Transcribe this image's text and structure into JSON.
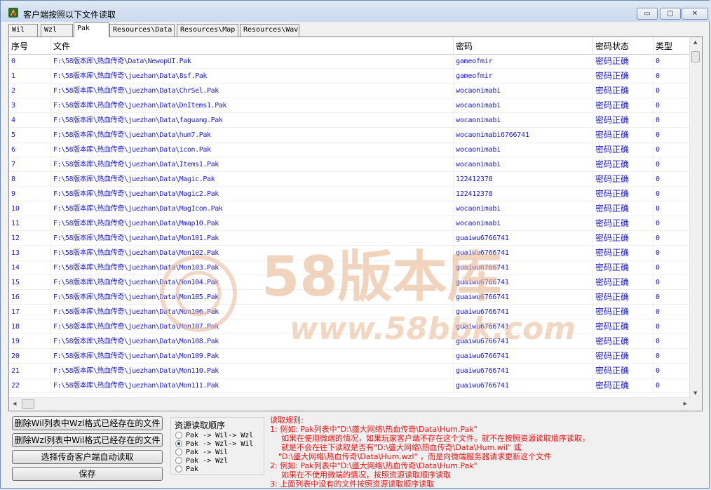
{
  "window": {
    "title": "客户端按照以下文件读取",
    "minimize": "▭",
    "maximize": "▢",
    "close": "✕"
  },
  "tabs": [
    "Wil",
    "Wzl",
    "Pak",
    "Resources\\Data",
    "Resources\\Map",
    "Resources\\Wav"
  ],
  "active_tab": "Pak",
  "table": {
    "headers": [
      "序号",
      "文件",
      "密码",
      "密码状态",
      "类型"
    ],
    "rows": [
      [
        "0",
        "F:\\58版本库\\热血传奇\\Data\\NewopUI.Pak",
        "gameofmir",
        "密码正确",
        "0"
      ],
      [
        "1",
        "F:\\58版本库\\热血传奇\\juezhan\\Data\\8sf.Pak",
        "gameofmir",
        "密码正确",
        "0"
      ],
      [
        "2",
        "F:\\58版本库\\热血传奇\\juezhan\\Data\\ChrSel.Pak",
        "wocaonimabi",
        "密码正确",
        "0"
      ],
      [
        "3",
        "F:\\58版本库\\热血传奇\\juezhan\\Data\\DnItems1.Pak",
        "wocaonimabi",
        "密码正确",
        "0"
      ],
      [
        "4",
        "F:\\58版本库\\热血传奇\\juezhan\\Data\\faguang.Pak",
        "wocaonimabi",
        "密码正确",
        "0"
      ],
      [
        "5",
        "F:\\58版本库\\热血传奇\\juezhan\\Data\\hum7.Pak",
        "wocaonimabi6766741",
        "密码正确",
        "0"
      ],
      [
        "6",
        "F:\\58版本库\\热血传奇\\juezhan\\Data\\icon.Pak",
        "wocaonimabi",
        "密码正确",
        "0"
      ],
      [
        "7",
        "F:\\58版本库\\热血传奇\\juezhan\\Data\\Items1.Pak",
        "wocaonimabi",
        "密码正确",
        "0"
      ],
      [
        "8",
        "F:\\58版本库\\热血传奇\\juezhan\\Data\\Magic.Pak",
        "122412378",
        "密码正确",
        "0"
      ],
      [
        "9",
        "F:\\58版本库\\热血传奇\\juezhan\\Data\\Magic2.Pak",
        "122412378",
        "密码正确",
        "0"
      ],
      [
        "10",
        "F:\\58版本库\\热血传奇\\juezhan\\Data\\MagIcon.Pak",
        "wocaonimabi",
        "密码正确",
        "0"
      ],
      [
        "11",
        "F:\\58版本库\\热血传奇\\juezhan\\Data\\Mmap10.Pak",
        "wocaonimabi",
        "密码正确",
        "0"
      ],
      [
        "12",
        "F:\\58版本库\\热血传奇\\juezhan\\Data\\Mon101.Pak",
        "guaiwu6766741",
        "密码正确",
        "0"
      ],
      [
        "13",
        "F:\\58版本库\\热血传奇\\juezhan\\Data\\Mon102.Pak",
        "guaiwu6766741",
        "密码正确",
        "0"
      ],
      [
        "14",
        "F:\\58版本库\\热血传奇\\juezhan\\Data\\Mon103.Pak",
        "guaiwu6766741",
        "密码正确",
        "0"
      ],
      [
        "15",
        "F:\\58版本库\\热血传奇\\juezhan\\Data\\Mon104.Pak",
        "guaiwu6766741",
        "密码正确",
        "0"
      ],
      [
        "16",
        "F:\\58版本库\\热血传奇\\juezhan\\Data\\Mon105.Pak",
        "guaiwu6766741",
        "密码正确",
        "0"
      ],
      [
        "17",
        "F:\\58版本库\\热血传奇\\juezhan\\Data\\Mon106.Pak",
        "guaiwu6766741",
        "密码正确",
        "0"
      ],
      [
        "18",
        "F:\\58版本库\\热血传奇\\juezhan\\Data\\Mon107.Pak",
        "guaiwu6766741",
        "密码正确",
        "0"
      ],
      [
        "19",
        "F:\\58版本库\\热血传奇\\juezhan\\Data\\Mon108.Pak",
        "guaiwu6766741",
        "密码正确",
        "0"
      ],
      [
        "20",
        "F:\\58版本库\\热血传奇\\juezhan\\Data\\Mon109.Pak",
        "guaiwu6766741",
        "密码正确",
        "0"
      ],
      [
        "21",
        "F:\\58版本库\\热血传奇\\juezhan\\Data\\Mon110.Pak",
        "guaiwu6766741",
        "密码正确",
        "0"
      ],
      [
        "22",
        "F:\\58版本库\\热血传奇\\juezhan\\Data\\Mon111.Pak",
        "guaiwu6766741",
        "密码正确",
        "0"
      ]
    ]
  },
  "watermark": {
    "brand": "58版本库",
    "url": "www.58bbk.com"
  },
  "buttons": {
    "delete_wil": "删除Wil列表中Wzl格式已经存在的文件",
    "delete_wzl": "删除Wzl列表中Wil格式已经存在的文件",
    "select_client": "选择传奇客户端自动读取",
    "save": "保存"
  },
  "resource_order": {
    "title": "资源读取顺序",
    "options": [
      "Pak -> Wil-> Wzl",
      "Pak -> Wzl-> Wil",
      "Pak -> Wil",
      "Pak -> Wzl",
      "Pak"
    ],
    "selected_index": 1
  },
  "rules": {
    "title": "读取规则:",
    "lines": [
      "1: 例如: Pak列表中\"D:\\盛大网络\\热血传奇\\Data\\Hum.Pak\"",
      "如果在使用微端的情况，如果玩家客户端不存在这个文件，就不在按照资源读取顺序读取，",
      "就是不会在往下读取是否有\"D:\\盛大网络\\热血传奇\\Data\\Hum.wil\" 或",
      "\"D:\\盛大网络\\热血传奇\\Data\\Hum.wzl\" ，而是向微端服务器请求更新这个文件",
      "2: 例如: Pak列表中\"D:\\盛大网络\\热血传奇\\Data\\Hum.Pak\"",
      "如果在不使用微端的情况，按照资源读取顺序读取",
      "3: 上面列表中没有的文件按照资源读取顺序读取"
    ]
  },
  "colors": {
    "list_text": "#1b1bc8",
    "rules_text": "#ee1111",
    "watermark": "#e8b893"
  }
}
